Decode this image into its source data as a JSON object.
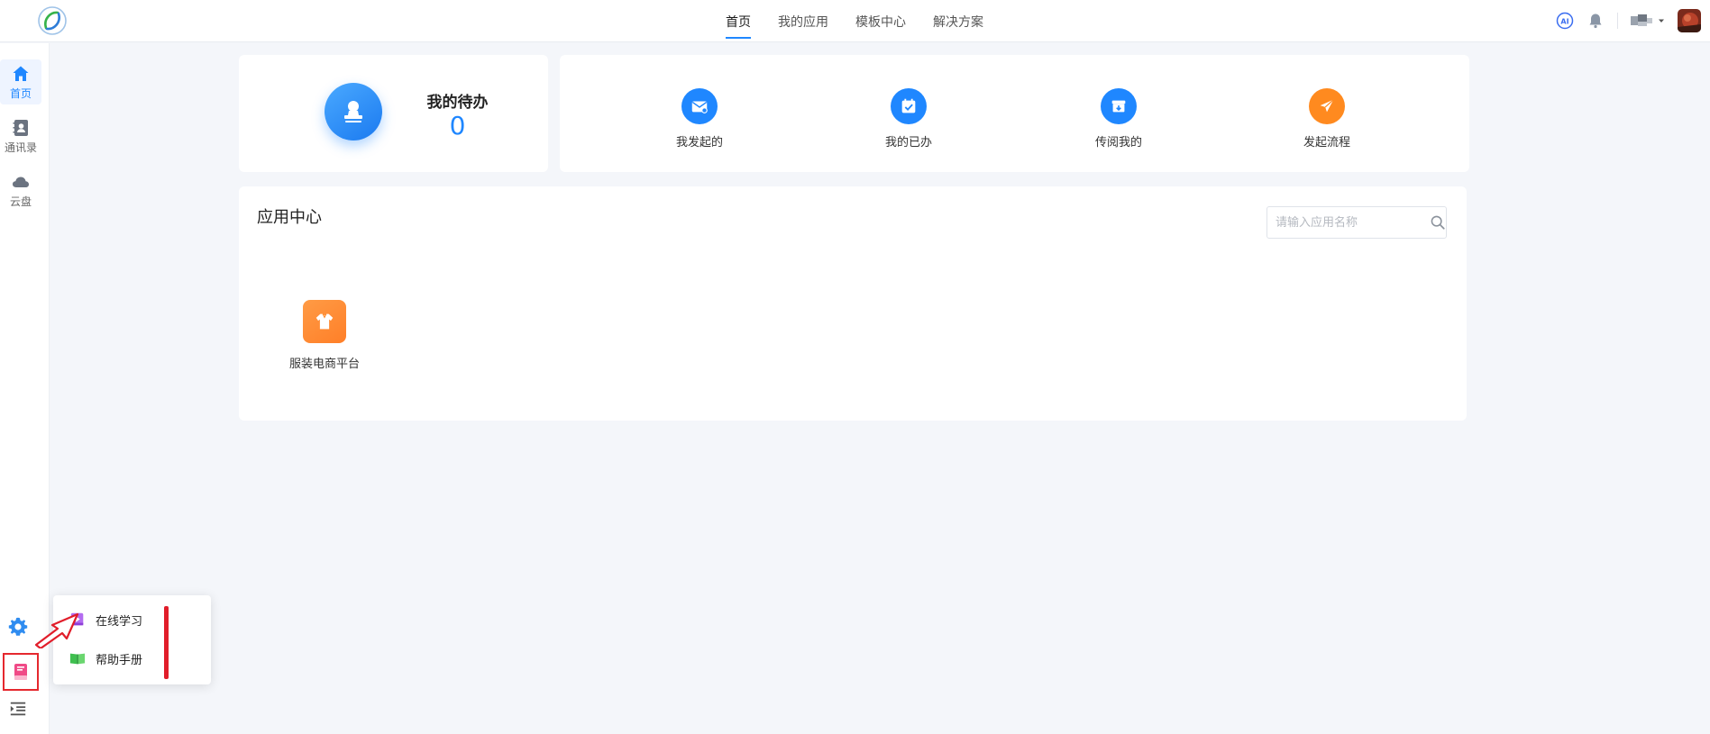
{
  "topbar": {
    "tabs": [
      {
        "label": "首页",
        "active": true
      },
      {
        "label": "我的应用",
        "active": false
      },
      {
        "label": "模板中心",
        "active": false
      },
      {
        "label": "解决方案",
        "active": false
      }
    ],
    "ai_badge": "AI"
  },
  "sidebar": {
    "items": [
      {
        "label": "首页",
        "icon": "home-icon",
        "active": true
      },
      {
        "label": "通讯录",
        "icon": "contacts-icon",
        "active": false
      },
      {
        "label": "云盘",
        "icon": "cloud-icon",
        "active": false
      }
    ]
  },
  "todo": {
    "title": "我的待办",
    "count": "0"
  },
  "quick_actions": [
    {
      "label": "我发起的",
      "icon": "mail-icon",
      "color": "#1f87ff"
    },
    {
      "label": "我的已办",
      "icon": "calendar-check-icon",
      "color": "#1f87ff"
    },
    {
      "label": "传阅我的",
      "icon": "inbox-icon",
      "color": "#1f87ff"
    },
    {
      "label": "发起流程",
      "icon": "paper-plane-icon",
      "color": "#ff8a1f"
    }
  ],
  "app_center": {
    "title": "应用中心",
    "search_placeholder": "请输入应用名称",
    "apps": [
      {
        "label": "服装电商平台",
        "icon": "shirt-icon",
        "color": "#ff8a2a"
      }
    ]
  },
  "help_menu": {
    "items": [
      {
        "label": "在线学习",
        "icon": "video-icon"
      },
      {
        "label": "帮助手册",
        "icon": "book-open-icon"
      }
    ]
  },
  "colors": {
    "accent": "#1f87ff",
    "highlight_red": "#e11d2a"
  }
}
